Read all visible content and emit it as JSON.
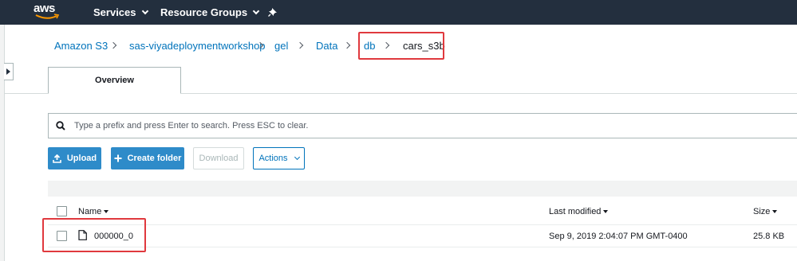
{
  "topnav": {
    "logo_text": "aws",
    "services_label": "Services",
    "resource_groups_label": "Resource Groups"
  },
  "breadcrumb": {
    "items": [
      "Amazon S3",
      "sas-viyadeploymentworkshop",
      "gel",
      "Data",
      "db",
      "cars_s3b"
    ]
  },
  "tabs": {
    "overview_label": "Overview"
  },
  "search": {
    "placeholder": "Type a prefix and press Enter to search. Press ESC to clear."
  },
  "toolbar": {
    "upload_label": "Upload",
    "create_folder_label": "Create folder",
    "download_label": "Download",
    "actions_label": "Actions"
  },
  "table": {
    "columns": {
      "name": "Name",
      "last_modified": "Last modified",
      "size": "Size"
    },
    "rows": [
      {
        "name": "000000_0",
        "last_modified": "Sep 9, 2019 2:04:07 PM GMT-0400",
        "size": "25.8 KB"
      }
    ]
  },
  "colors": {
    "nav_bg": "#232f3e",
    "link": "#0073bb",
    "primary_button": "#2e8bc9",
    "highlight": "#e0393e"
  }
}
